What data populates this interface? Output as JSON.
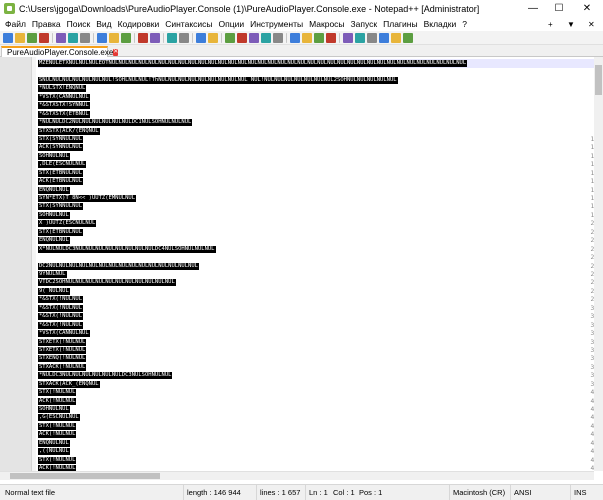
{
  "window": {
    "title": "C:\\Users\\jgoga\\Downloads\\PureAudioPlayer.Console (1)\\PureAudioPlayer.Console.exe - Notepad++ [Administrator]",
    "minimize": "—",
    "maximize": "☐",
    "close": "✕"
  },
  "menu": {
    "items": [
      "Файл",
      "Правка",
      "Поиск",
      "Вид",
      "Кодировки",
      "Синтаксисы",
      "Опции",
      "Инструменты",
      "Макросы",
      "Запуск",
      "Плагины",
      "Вкладки",
      "?"
    ],
    "plus": "+",
    "arrow": "▼",
    "close_x": "✕"
  },
  "toolbar": {
    "icons": [
      "new-file-icon",
      "open-file-icon",
      "save-icon",
      "save-all-icon",
      "close-icon",
      "close-all-icon",
      "print-icon",
      "cut-icon",
      "copy-icon",
      "paste-icon",
      "undo-icon",
      "redo-icon",
      "find-icon",
      "replace-icon",
      "zoom-in-icon",
      "zoom-out-icon",
      "sync-vertical-icon",
      "sync-horizontal-icon",
      "word-wrap-icon",
      "show-all-chars-icon",
      "indent-guide-icon",
      "language-icon",
      "doc-map-icon",
      "function-list-icon",
      "folder-workspace-icon",
      "monitor-icon",
      "record-macro-icon",
      "stop-record-icon",
      "playback-icon",
      "run-macro-icon",
      "save-macro-icon"
    ]
  },
  "tab": {
    "label": "PureAudioPlayer.Console.exe",
    "close": "✕"
  },
  "editor": {
    "lines": [
      {
        "n": "1",
        "text": "MZÉNULETXNULNULNULEOTNULNULNULNULNULNULNULNULNULNULNULNULNULNULNULNULNULNULNULNULNULNULNULNULNULNULNULNULNULNULNULNULNULNULNULNUL"
      },
      {
        "n": "2",
        "text": ""
      },
      {
        "n": "3",
        "text": "SNULNULNULNULNULNULNUL!SOHLNULNUL!ThNULNULNULNULNULNULNULNULNUL NUL!NULNULNULNULNULNULNUL2SOHNULNULNULNULNUL"
      },
      {
        "n": "4",
        "text": "*NULSTX!ENQNUL"
      },
      {
        "n": "5",
        "text": "*VSTX(CANNULNUL"
      },
      {
        "n": "6",
        "text": "*&STXSTX!SYNNUL"
      },
      {
        "n": "7",
        "text": "*&STXSTX(ETBNUL"
      },
      {
        "n": "8",
        "text": "*NULNULDC2NULNULNULNULNULNULDC1NULSOHNULNULNUL"
      },
      {
        "n": "9",
        "text": "STXSTX(ACK/(ENQNUL"
      },
      {
        "n": "10",
        "text": "STX(SYNNULNUL"
      },
      {
        "n": "11",
        "text": "ACK(SYNNULNUL"
      },
      {
        "n": "12",
        "text": "SOHNULNUL"
      },
      {
        "n": "13",
        "text": ",DLE(ESCNULNUL"
      },
      {
        "n": "14",
        "text": "STX(ETBNULNUL"
      },
      {
        "n": "15",
        "text": "ACK(ETBNULNUL"
      },
      {
        "n": "16",
        "text": "ENQNULNUL"
      },
      {
        "n": "17",
        "text": "SYN*ETX)T 8Ñ<< )UUTZ(EMNULNUL"
      },
      {
        "n": "18",
        "text": "STX(SYNNULNUL"
      },
      {
        "n": "19",
        "text": "SOHNULNUL"
      },
      {
        "n": "20",
        "text": "X )UUTZ(ESCNULNUL"
      },
      {
        "n": "21",
        "text": "STX(ETBNULNUL"
      },
      {
        "n": "22",
        "text": "ENQNULNUL"
      },
      {
        "n": "23",
        "text": "X*NULNULDC3NULNULNULNULNULNULNULNULDC4NULSOHNULNULNUL"
      },
      {
        "n": "24",
        "text": ""
      },
      {
        "n": "25",
        "text": "DC2NULNULNULNULNULNULNULNULNULNULNULNULNULNULNUL"
      },
      {
        "n": "26",
        "text": "9YNULNUL"
      },
      {
        "n": "27",
        "text": "VTDC2SOHNULNULNULNULNULNULNULNULNULNULNUL"
      },
      {
        "n": "28",
        "text": "9( NULNUL"
      },
      {
        "n": "29",
        "text": "*&STX(!NULNUL"
      },
      {
        "n": "30",
        "text": "*&STX(!NULNUL"
      },
      {
        "n": "31",
        "text": "*&STX(!NULNUL"
      },
      {
        "n": "32",
        "text": "*&STX(!NULNUL"
      },
      {
        "n": "33",
        "text": "*VSTX(CANNULNUL"
      },
      {
        "n": "34",
        "text": "STXETX(!NULNUL"
      },
      {
        "n": "35",
        "text": "STXETX(!NULNUL"
      },
      {
        "n": "36",
        "text": "STXENQ(!NULNUL"
      },
      {
        "n": "37",
        "text": "STXACK(!NULNUL"
      },
      {
        "n": "38",
        "text": "*NULDC3NULNULNULNULNULNULDC3NULSOHNULNUL"
      },
      {
        "n": "39",
        "text": "STXACK(ACK_(ENQNUL"
      },
      {
        "n": "40",
        "text": "STX(!NULNUL"
      },
      {
        "n": "41",
        "text": "ACK(!NULNUL"
      },
      {
        "n": "42",
        "text": "SOHNULNUL"
      },
      {
        "n": "43",
        "text": ",G(ESCNULNUL"
      },
      {
        "n": "44",
        "text": "STX(!NULNUL"
      },
      {
        "n": "45",
        "text": "ACK(!NULNUL"
      },
      {
        "n": "46",
        "text": "ENQNULNUL"
      },
      {
        "n": "47",
        "text": ",((NULNUL"
      },
      {
        "n": "48",
        "text": "STX(!NULNUL"
      },
      {
        "n": "49",
        "text": "ACK(!NULNUL"
      }
    ]
  },
  "status": {
    "file_type": "Normal text file",
    "length": "length : 146 944",
    "lines": "lines : 1 657",
    "ln": "Ln : 1",
    "col": "Col : 1",
    "pos": "Pos : 1",
    "eol": "Macintosh (CR)",
    "encoding": "ANSI",
    "mode": "INS"
  }
}
